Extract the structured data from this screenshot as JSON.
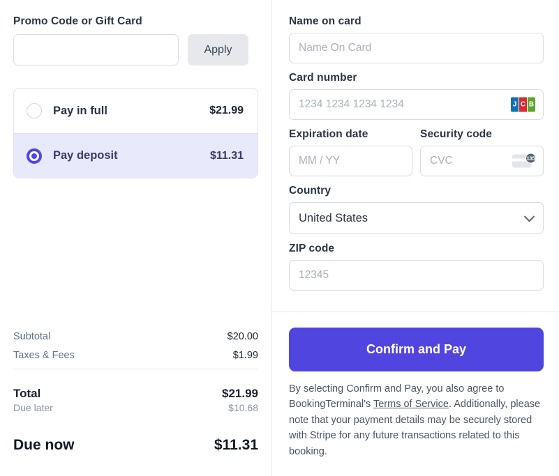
{
  "left": {
    "promo": {
      "label": "Promo Code or Gift Card",
      "input_value": "",
      "input_placeholder": "",
      "apply_label": "Apply"
    },
    "payment_options": [
      {
        "label": "Pay in full",
        "amount": "$21.99",
        "selected": false
      },
      {
        "label": "Pay deposit",
        "amount": "$11.31",
        "selected": true
      }
    ],
    "summary": [
      {
        "label": "Subtotal",
        "value": "$20.00"
      },
      {
        "label": "Taxes & Fees",
        "value": "$1.99"
      }
    ],
    "total": {
      "label": "Total",
      "value": "$21.99"
    },
    "due_later": {
      "label": "Due later",
      "value": "$10.68"
    },
    "due_now": {
      "label": "Due now",
      "value": "$11.31"
    }
  },
  "right": {
    "name_on_card": {
      "label": "Name on card",
      "value": "",
      "placeholder": "Name On Card"
    },
    "card_number": {
      "label": "Card number",
      "value": "",
      "placeholder": "1234 1234 1234 1234",
      "brand_icon": "jcb-card-icon",
      "brand_letters": [
        "J",
        "C",
        "B"
      ]
    },
    "expiration": {
      "label": "Expiration date",
      "value": "",
      "placeholder": "MM / YY"
    },
    "security_code": {
      "label": "Security code",
      "value": "",
      "placeholder": "CVC",
      "hint_icon_digits": "135"
    },
    "country": {
      "label": "Country",
      "selected": "United States"
    },
    "zip": {
      "label": "ZIP code",
      "value": "",
      "placeholder": "12345"
    },
    "submit_label": "Confirm and Pay",
    "legal": {
      "part1": "By selecting Confirm and Pay, you also agree to BookingTerminal's ",
      "link": "Terms of Service",
      "part2": ". Additionally, please note that your payment details may be securely stored with Stripe for any future transactions related to this booking."
    }
  },
  "colors": {
    "accent": "#5145e0",
    "selected_bg": "#e8e9fb",
    "jcb_blue": "#0f72b5",
    "jcb_red": "#d92b2b",
    "jcb_green": "#5aa832"
  }
}
